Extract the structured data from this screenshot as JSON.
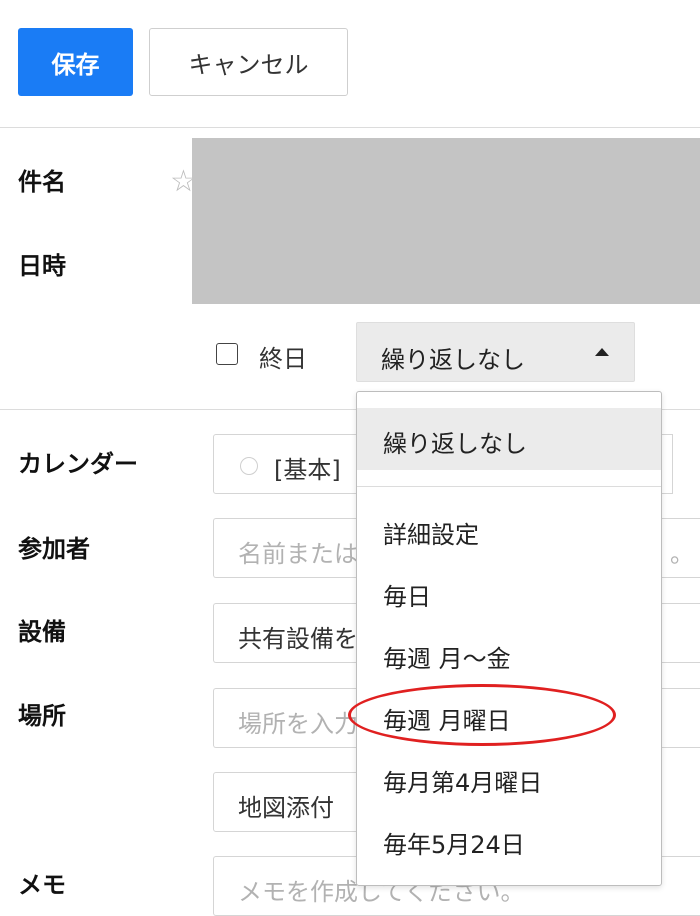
{
  "toolbar": {
    "save_label": "保存",
    "cancel_label": "キャンセル"
  },
  "form": {
    "subject_label": "件名",
    "datetime_label": "日時",
    "allday_label": "終日",
    "repeat_value": "繰り返しなし",
    "calendar_label": "カレンダー",
    "calendar_value": "[基本]",
    "participants_label": "参加者",
    "participants_placeholder_left": "名前または",
    "participants_placeholder_right": "。",
    "facility_label": "設備",
    "facility_value": "共有設備を",
    "place_label": "場所",
    "place_placeholder": "場所を入力",
    "map_attach_label": "地図添付",
    "memo_label": "メモ",
    "memo_placeholder": "メモを作成してください。"
  },
  "repeat_menu": {
    "items": [
      "繰り返しなし",
      "詳細設定",
      "毎日",
      "毎週 月〜金",
      "毎週 月曜日",
      "毎月第4月曜日",
      "毎年5月24日"
    ],
    "selected_index": 0,
    "highlighted_index": 4
  },
  "colors": {
    "primary": "#1a7cf5",
    "annotation": "#e02020",
    "redacted": "#c4c4c4"
  },
  "icons": {
    "favorite": "star-outline-icon",
    "dropdown": "caret-up-icon"
  }
}
